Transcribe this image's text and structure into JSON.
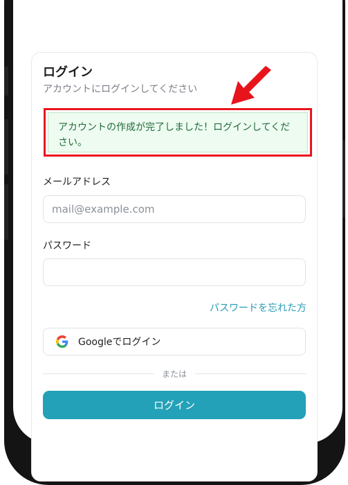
{
  "login": {
    "title": "ログイン",
    "subtitle": "アカウントにログインしてください",
    "success_message": "アカウントの作成が完了しました！ログインしてください。",
    "email": {
      "label": "メールアドレス",
      "placeholder": "mail@example.com",
      "value": ""
    },
    "password": {
      "label": "パスワード",
      "placeholder": "",
      "value": ""
    },
    "forgot_password": "パスワードを忘れた方",
    "google_button": "Googleでログイン",
    "divider_text": "または",
    "submit_button": "ログイン"
  },
  "colors": {
    "accent": "#23a1b8",
    "success_bg": "#eefbf1",
    "success_text": "#1f6b3a",
    "highlight": "#e8141c"
  },
  "icons": [
    "google-icon",
    "red-arrow-icon"
  ]
}
